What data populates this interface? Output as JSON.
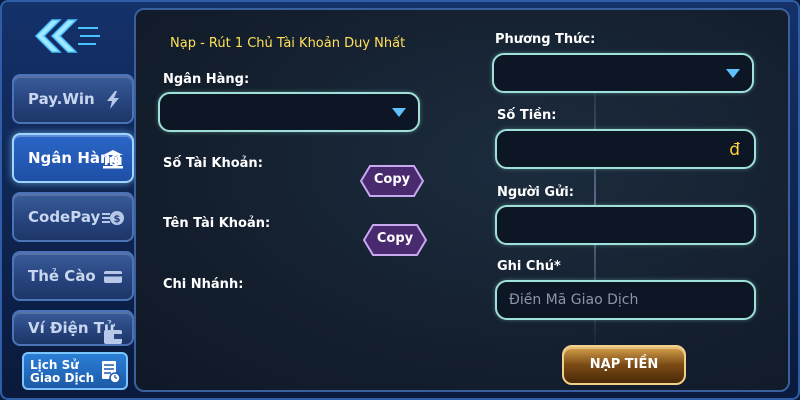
{
  "sidebar": {
    "tabs": [
      {
        "label": "Pay.Win"
      },
      {
        "label": "Ngân Hàng"
      },
      {
        "label": "CodePay"
      },
      {
        "label": "Thẻ Cào"
      },
      {
        "label": "Ví Điện Tử"
      }
    ],
    "history_line1": "Lịch Sử",
    "history_line2": "Giao Dịch",
    "help": "?"
  },
  "panel": {
    "notice": "Nạp - Rút 1 Chủ Tài Khoản Duy Nhất",
    "bank_label": "Ngân Hàng:",
    "account_number_label": "Số Tài Khoản:",
    "account_name_label": "Tên Tài Khoản:",
    "branch_label": "Chi Nhánh:",
    "copy_label": "Copy",
    "method_label": "Phương Thức:",
    "amount_label": "Số Tiền:",
    "currency_symbol": "đ",
    "sender_label": "Người Gửi:",
    "note_label": "Ghi Chú*",
    "note_placeholder": "Điền Mã Giao Dịch",
    "submit_label": "NẠP TIỀN"
  },
  "colors": {
    "accent_yellow": "#ffe15a",
    "field_border": "#9fe0d8",
    "active_tab_glow": "#9fd6ff"
  },
  "icons": [
    "double-chevron-left-icon",
    "lightning-icon",
    "bank-icon",
    "coin-stack-icon",
    "card-icon",
    "wallet-icon",
    "document-clock-icon",
    "dropdown-caret-icon"
  ]
}
